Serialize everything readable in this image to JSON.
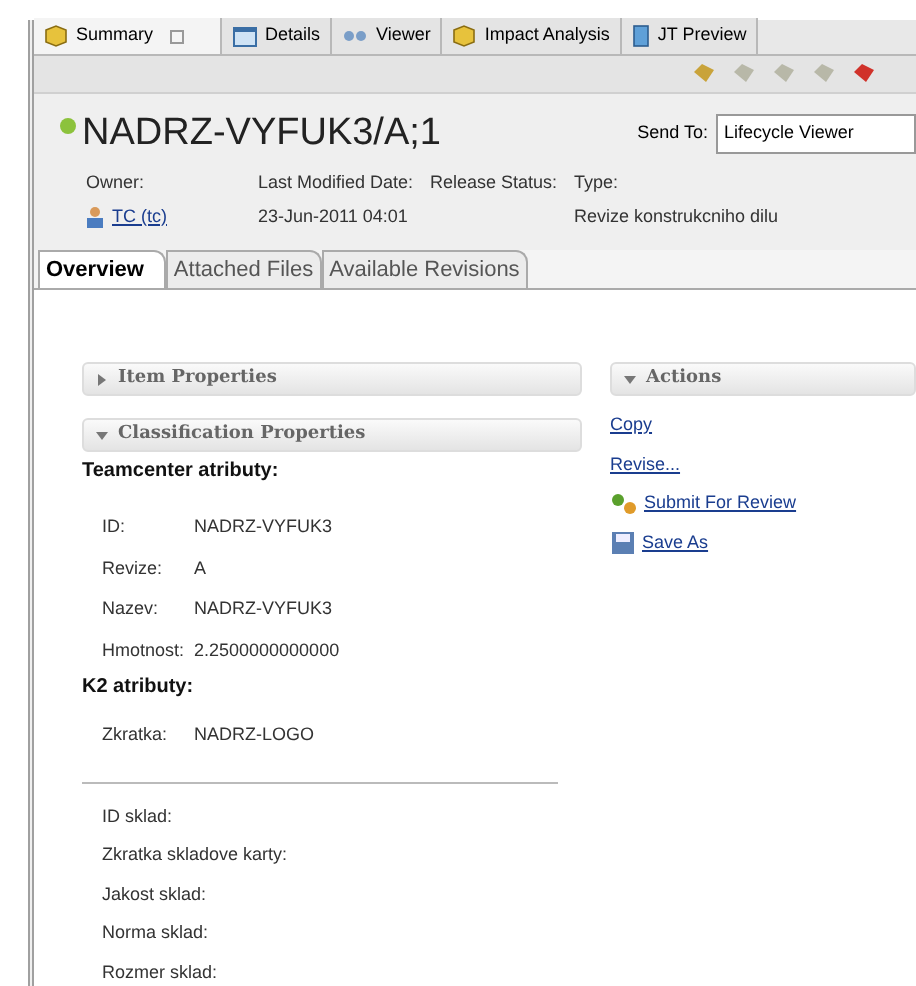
{
  "editor_tabs": [
    {
      "label": "Summary",
      "selected": true,
      "closable": true,
      "kind": "cube"
    },
    {
      "label": "Details",
      "selected": false,
      "closable": false,
      "kind": "table"
    },
    {
      "label": "Viewer",
      "selected": false,
      "closable": false,
      "kind": "glasses"
    },
    {
      "label": "Impact Analysis",
      "selected": false,
      "closable": false,
      "kind": "cube"
    },
    {
      "label": "JT Preview",
      "selected": false,
      "closable": false,
      "kind": "file"
    }
  ],
  "header": {
    "title": "NADRZ-VYFUK3/A;1",
    "send_to": {
      "label": "Send To:",
      "value": "Lifecycle Viewer"
    },
    "fields": [
      {
        "label": "Owner:",
        "value": "TC (tc)",
        "kind": "user"
      },
      {
        "label": "Last Modified Date:",
        "value": "23-Jun-2011 04:01",
        "kind": "text"
      },
      {
        "label": "Release Status:",
        "kind": "text"
      },
      {
        "label": "Type:",
        "value": "Revize konstrukcniho dilu",
        "kind": "text"
      }
    ]
  },
  "page_tabs": [
    {
      "label": "Overview",
      "selected": true
    },
    {
      "label": "Attached Files",
      "selected": false
    },
    {
      "label": "Available Revisions",
      "selected": false
    }
  ],
  "sections": [
    {
      "title": "Item Properties",
      "expanded": false
    },
    {
      "title": "Classification Properties",
      "expanded": true
    }
  ],
  "classification": {
    "groups": [
      {
        "heading": "Teamcenter atributy:",
        "rows": [
          {
            "label": "ID:",
            "value": "NADRZ-VYFUK3"
          },
          {
            "label": "Revize:",
            "value": "A"
          },
          {
            "label": "Nazev:",
            "value": "NADRZ-VYFUK3"
          },
          {
            "label": "Hmotnost:",
            "value": "2.2500000000000"
          }
        ]
      },
      {
        "heading": "K2 atributy:",
        "rows": [
          {
            "label": "Zkratka:",
            "value": "NADRZ-LOGO"
          }
        ]
      }
    ],
    "extra_rows": [
      "ID sklad:",
      "Zkratka skladove karty:",
      "Jakost sklad:",
      "Norma sklad:",
      "Rozmer sklad:"
    ]
  },
  "actions": {
    "title": "Actions",
    "expanded": true,
    "items": [
      {
        "label": "Copy",
        "kind": "plain"
      },
      {
        "label": "Revise...",
        "kind": "plain"
      },
      {
        "label": "Submit For Review",
        "kind": "workflow"
      },
      {
        "label": "Save As",
        "kind": "save"
      }
    ]
  }
}
